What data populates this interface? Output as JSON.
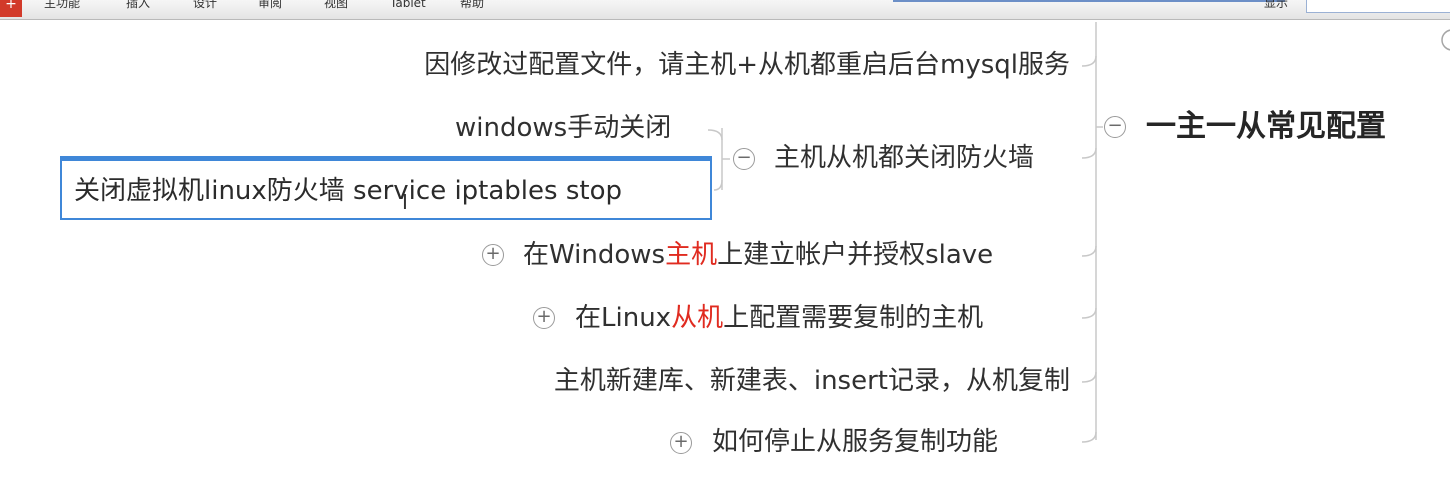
{
  "menubar": {
    "items": [
      "主功能",
      "插入",
      "设计",
      "审阅",
      "视图",
      "Tablet",
      "帮助"
    ],
    "right_tab": "显示"
  },
  "mindmap": {
    "root": "一主一从常见配置",
    "nodes": {
      "restart": "因修改过配置文件，请主机+从机都重启后台mysql服务",
      "firewall": "主机从机都关闭防火墙",
      "firewall_windows": "windows手动关闭",
      "firewall_linux_edit": "关闭虚拟机linux防火墙   service iptables stop",
      "account_prefix": "在Windows",
      "account_hl": "主机",
      "account_suffix": "上建立帐户并授权slave",
      "linux_prefix": "在Linux",
      "linux_hl": "从机",
      "linux_suffix": "上配置需要复制的主机",
      "insert": "主机新建库、新建表、insert记录，从机复制",
      "stop": "如何停止从服务复制功能"
    }
  },
  "colors": {
    "highlight": "#e02b20",
    "selection": "#3f87d8",
    "connector": "#c8c8c8"
  }
}
